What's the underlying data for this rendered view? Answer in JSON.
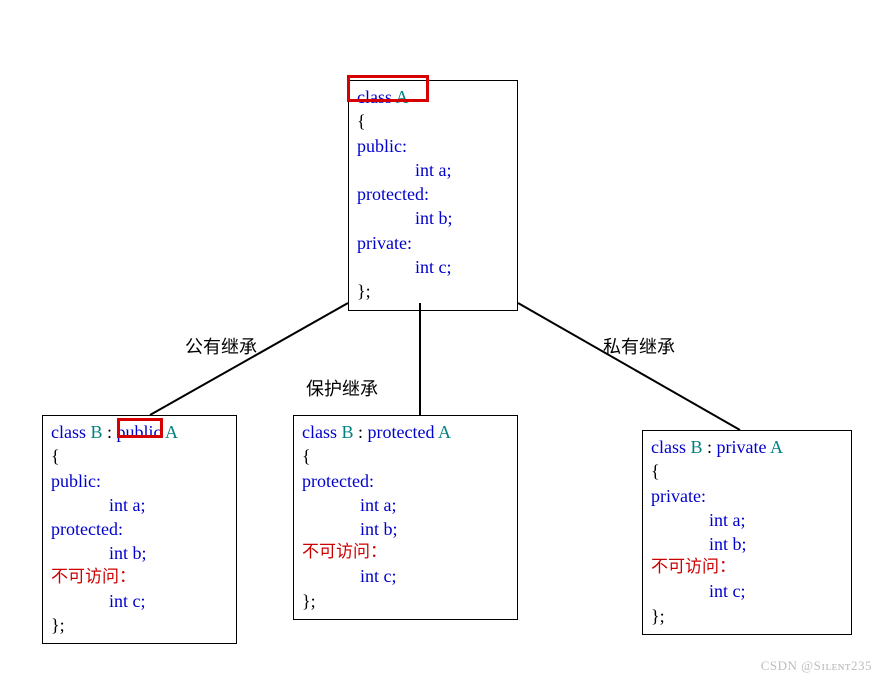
{
  "classA": {
    "header_kw": "class",
    "header_name": "A",
    "open": "{",
    "sections": [
      {
        "label": "public:",
        "members": [
          "int a;"
        ]
      },
      {
        "label": "protected:",
        "members": [
          "int b;"
        ]
      },
      {
        "label": "private:",
        "members": [
          "int c;"
        ]
      }
    ],
    "close": "};"
  },
  "edges": {
    "left": {
      "label": "公有继承"
    },
    "middle": {
      "label": "保护继承"
    },
    "right": {
      "label": "私有继承"
    }
  },
  "public_box": {
    "header_kw": "class",
    "header_name": "B",
    "colon": " : ",
    "inh_kw": "public",
    "inh_name": "A",
    "open": "{",
    "sections": [
      {
        "label": "public:",
        "members": [
          "int a;"
        ]
      },
      {
        "label": "protected:",
        "members": [
          "int b;"
        ]
      }
    ],
    "inaccessible_label": "不可访问：",
    "inaccessible_members": [
      "int c;"
    ],
    "close": "};"
  },
  "protected_box": {
    "header_kw": "class",
    "header_name": "B",
    "colon": " : ",
    "inh_kw": "protected",
    "inh_name": "A",
    "open": "{",
    "sections": [
      {
        "label": "protected:",
        "members": [
          "int a;",
          "int b;"
        ]
      }
    ],
    "inaccessible_label": "不可访问：",
    "inaccessible_members": [
      "int c;"
    ],
    "close": "};"
  },
  "private_box": {
    "header_kw": "class",
    "header_name": "B",
    "colon": " :",
    "inh_kw": "private",
    "inh_name": "A",
    "open": "{",
    "sections": [
      {
        "label": "private:",
        "members": [
          "int a;",
          "int b;"
        ]
      }
    ],
    "inaccessible_label": "不可访问：",
    "inaccessible_members": [
      "int c;"
    ],
    "close": "};"
  },
  "watermark": "CSDN @Sɪʟᴇɴᴛ235"
}
